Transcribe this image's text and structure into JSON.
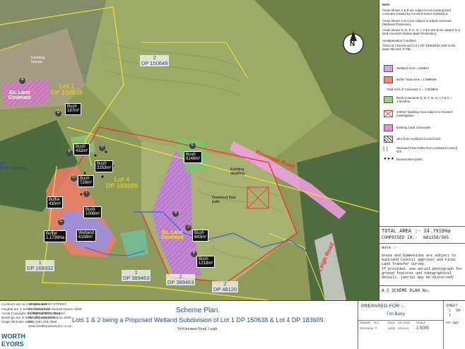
{
  "map": {
    "compass": {
      "letter": "N"
    },
    "lots": [
      {
        "id": "lot1",
        "line1": "Lot 1",
        "line2": "DP 150638"
      },
      {
        "id": "lot4",
        "line1": "Lot 4",
        "line2": "DP 183609"
      }
    ],
    "dp_labels": [
      {
        "id": "dp-top",
        "line1": "2",
        "line2": "DP 150648"
      },
      {
        "id": "dp-bl",
        "line1": "1",
        "line2": "DP 169332"
      },
      {
        "id": "dp-b1",
        "line1": "1",
        "line2": "DP 389463"
      },
      {
        "id": "dp-b2",
        "line1": "2",
        "line2": "DP 389463"
      },
      {
        "id": "dp-br",
        "line1": "2",
        "line2": "DP 48120"
      }
    ],
    "area_labels": [
      {
        "id": "bush-a",
        "line1": "Bush",
        "line2": "187m²"
      },
      {
        "id": "bush-b",
        "line1": "Bush",
        "line2": "432m²"
      },
      {
        "id": "bush-c",
        "line1": "Bush",
        "line2": "729m²"
      },
      {
        "id": "bush-d",
        "line1": "Bush",
        "line2": "2253m²"
      },
      {
        "id": "bush-e",
        "line1": "Bush",
        "line2": "6148m²"
      },
      {
        "id": "bush-f",
        "line1": "Bush",
        "line2": "1006m²"
      },
      {
        "id": "bush-g",
        "line1": "Bush",
        "line2": "643m²"
      },
      {
        "id": "bush-h",
        "line1": "Bush",
        "line2": "1218m²"
      },
      {
        "id": "buffer-a",
        "line1": "Buffer",
        "line2": "430m²"
      },
      {
        "id": "buffer-b",
        "line1": "Buffer",
        "line2": "1.1739Ha"
      },
      {
        "id": "wetland",
        "line1": "Wetland",
        "line2": "6158m²"
      }
    ],
    "covenant_labels": [
      {
        "id": "ex-cov-1",
        "line1": "Ex. Land",
        "line2": "Covenant"
      },
      {
        "id": "ex-cov-2",
        "line1": "Ex. Land",
        "line2": "Covenant"
      }
    ],
    "letters": [
      "A",
      "B",
      "C",
      "D",
      "E",
      "F",
      "G",
      "H",
      "I",
      "J",
      "K"
    ],
    "road_labels": [
      {
        "id": "kourawai-road",
        "text": "Kourawai Road"
      },
      {
        "id": "leigh-road",
        "text": "Leigh Road"
      }
    ],
    "annotations": [
      {
        "id": "existing-house",
        "line1": "Existing",
        "line2": "House"
      },
      {
        "id": "existing-dwelling",
        "line1": "Existing",
        "line2": "dwelling"
      },
      {
        "id": "overland-flow",
        "line1": "Overland flow",
        "line2": "path"
      }
    ],
    "left_edge": {
      "line1": "en",
      "line2": "8 of Stroma"
    }
  },
  "legend": {
    "notes_heading": "Note:",
    "notes": [
      "Areas shown A & B are subject to an existing land covenant created by Consent Notice 5229101.2",
      "Areas shown C is to be subject to a land covenant (Wetland Protection).",
      "Areas shown D, E, F, G, H, I, J & K are to be subject to a land covenant (Native Bush Protection).",
      "Amalgamation Condition",
      "That Lot 2 herein and Lot 1 DP 150638 be held in the same Record of Title."
    ],
    "items": [
      {
        "id": "wetland",
        "text": "Wetland Area = 6158m²",
        "color": "#c9a8e6"
      },
      {
        "id": "buffer",
        "text": "Buffer Total Area = 1.5999Ha",
        "color": "#f08a7c"
      },
      {
        "id": "total",
        "text": "Total Area of Covenant C = 1.8228Ha",
        "color": ""
      },
      {
        "id": "bush",
        "text": "Bush Covenants D, E, F, G, H, I, J & K = 1.5244Ha",
        "color": "#9ccc7e"
      },
      {
        "id": "building",
        "text": "2000m² Building Area subject to Geotech Investigation",
        "color": ""
      },
      {
        "id": "existing",
        "text": "Existing Land Covenants",
        "color": "#f088e0"
      },
      {
        "id": "sea",
        "text": "SEA from Auckland Council GIS",
        "color": ""
      },
      {
        "id": "flood",
        "text": "Overland Flow Paths from Auckland Council GIS",
        "color": ""
      },
      {
        "id": "demarcation",
        "text": "Demarcation posts",
        "color": ""
      }
    ],
    "total_area_label": "TOTAL AREA",
    "total_area_value": ":- 24.7919Ha",
    "comprised_label": "COMPRISED IN:-",
    "comprised_value": "NA135B/985",
    "note2_heading": "Note :-",
    "note2_lines": [
      "Areas and Dimensions are subject to Auckland Council approval and Final Land Transfer Survey.",
      "If provided, see aerial photograph for ground features and topographical details. (Aerial may be distorted)"
    ],
    "scheme_label": "A C   SCHEME PLAN No."
  },
  "title_block": {
    "left_notes": [
      "Contours are at 0.5m intervals",
      "Heights are in terms of Auckland Vertical Datum 1946",
      "Aerial Copyright of LINZ/Auckland Council",
      "Bearings are in terms of Geodetic Datum 2000",
      "Origin Mt Eden 2000"
    ],
    "company": "WORTH\nEYORS",
    "address_lines": [
      "33 BEAUMONT STREET",
      "P.O. BOX 143",
      "WARKWORTH, 0941",
      "PH (09) 425-7363",
      "FAX (09) 425-7560",
      "www.woolleysurveyors.co.nz"
    ],
    "scheme_title": "Scheme Plan.",
    "scheme_subtitle": "Lots 1 & 2 being a Proposed Wetland Subdivision of Lot 1 DP 150638 & Lot 4 DP 183609.",
    "scheme_address": "54 Kourawai Road, Leigh.",
    "prepared_for_label": "PREPARED FOR :-",
    "prepared_for_value": "Tim Barry",
    "drawn_label": "DRAWN",
    "drawn_value": "W.C.",
    "dwg_label": "DWG",
    "dwg_value": "447-2016",
    "revision_label": "REVISION",
    "revision_value": "2",
    "date_label": "DATE",
    "date_value": "22/01/24",
    "scale_label": "SCALE",
    "scale_value": "1:5000",
    "sheet_label": "SHEET",
    "sheet_value": "1",
    "of_label": "OF",
    "sheet_total": "1",
    "ref_label": "REF",
    "ref_value": "447"
  }
}
